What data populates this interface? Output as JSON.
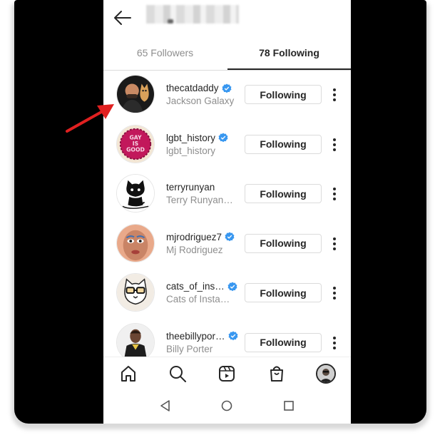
{
  "tabs": {
    "followers": "65 Followers",
    "following": "78 Following"
  },
  "accounts": [
    {
      "username": "thecatdaddy",
      "fullname": "Jackson Galaxy",
      "verified": true,
      "button": "Following",
      "avatar": "man-with-cat-avatar"
    },
    {
      "username": "lgbt_history",
      "fullname": "lgbt_history",
      "verified": true,
      "button": "Following",
      "avatar": "gay-is-good-avatar"
    },
    {
      "username": "terryrunyan",
      "fullname": "Terry Runyan…",
      "verified": false,
      "button": "Following",
      "avatar": "cat-drawing-avatar"
    },
    {
      "username": "mjrodriguez7",
      "fullname": "Mj Rodriguez",
      "verified": true,
      "button": "Following",
      "avatar": "woman-portrait-avatar"
    },
    {
      "username": "cats_of_ins…",
      "fullname": "Cats of Instag…",
      "verified": true,
      "button": "Following",
      "avatar": "cat-glasses-avatar"
    },
    {
      "username": "theebillypor…",
      "fullname": "Billy Porter",
      "verified": true,
      "button": "Following",
      "avatar": "man-portrait-avatar"
    }
  ],
  "bottom_nav": [
    "home-icon",
    "search-icon",
    "reels-icon",
    "shop-icon",
    "profile-avatar"
  ],
  "system_nav": [
    "back-triangle-icon",
    "home-circle-icon",
    "recents-square-icon"
  ],
  "colors": {
    "verified": "#3897f0",
    "annotation_arrow": "#e02020",
    "secondary_text": "#8e8e8e",
    "primary_text": "#262626"
  }
}
